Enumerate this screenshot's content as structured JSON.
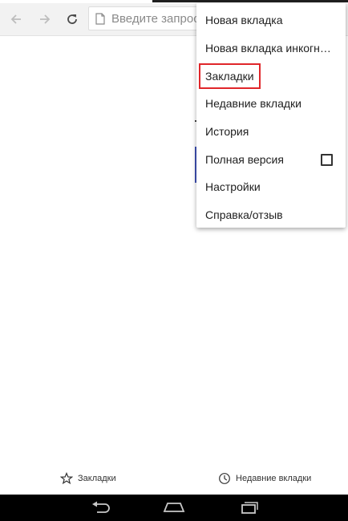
{
  "omnibox": {
    "placeholder": "Введите запрос"
  },
  "menu": {
    "items": [
      {
        "label": "Новая вкладка"
      },
      {
        "label": "Новая вкладка инкогнито"
      },
      {
        "label": "Закладки",
        "highlighted": true
      },
      {
        "label": "Недавние вкладки"
      },
      {
        "label": "История"
      },
      {
        "label": "Полная версия",
        "checkbox": false
      },
      {
        "label": "Настройки"
      },
      {
        "label": "Справка/отзыв"
      }
    ]
  },
  "bottom_bar": {
    "bookmarks_label": "Закладки",
    "recent_tabs_label": "Недавние вкладки"
  },
  "icons": {
    "back": "arrow-left-icon",
    "forward": "arrow-right-icon",
    "reload": "reload-icon",
    "page": "page-icon",
    "star": "star-icon",
    "clock": "clock-icon"
  },
  "colors": {
    "highlight_box": "#e0262a",
    "toolbar_bg": "#f2f2f2"
  }
}
